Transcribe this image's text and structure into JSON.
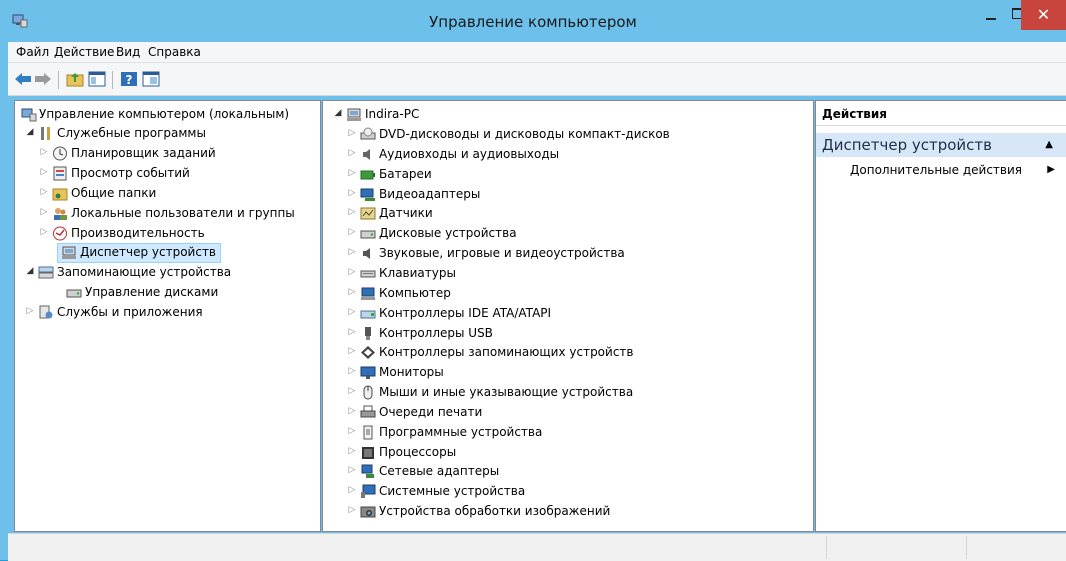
{
  "window": {
    "title": "Управление компьютером",
    "close_glyph": "✕"
  },
  "menu": [
    "Файл",
    "Действие",
    "Вид",
    "Справка"
  ],
  "toolbar": [
    "back-arrow-icon",
    "forward-arrow-icon",
    "up-folder-icon",
    "show-hide-tree-icon",
    "help-icon",
    "properties-icon"
  ],
  "left_tree": [
    {
      "label": "Управление компьютером (локальным)",
      "icon": "computer-management-icon",
      "expander": "",
      "level": 0
    },
    {
      "label": "Служебные программы",
      "icon": "tools-icon",
      "expander": "◢",
      "level": 1
    },
    {
      "label": "Планировщик заданий",
      "icon": "clock-icon",
      "expander": "▷",
      "level": 2
    },
    {
      "label": "Просмотр событий",
      "icon": "event-viewer-icon",
      "expander": "▷",
      "level": 2
    },
    {
      "label": "Общие папки",
      "icon": "shared-folder-icon",
      "expander": "▷",
      "level": 2
    },
    {
      "label": "Локальные пользователи и группы",
      "icon": "users-icon",
      "expander": "▷",
      "level": 2
    },
    {
      "label": "Производительность",
      "icon": "performance-icon",
      "expander": "▷",
      "level": 2
    },
    {
      "label": "Диспетчер устройств",
      "icon": "device-manager-icon",
      "expander": "",
      "level": 2,
      "selected": true
    },
    {
      "label": "Запоминающие устройства",
      "icon": "storage-icon",
      "expander": "◢",
      "level": 1
    },
    {
      "label": "Управление дисками",
      "icon": "disk-management-icon",
      "expander": "",
      "level": 2
    },
    {
      "label": "Службы и приложения",
      "icon": "services-icon",
      "expander": "▷",
      "level": 1
    }
  ],
  "device_tree": {
    "root": {
      "label": "Indira-PC",
      "icon": "computer-icon",
      "expander": "◢"
    },
    "items": [
      {
        "label": "DVD-дисководы и дисководы компакт-дисков",
        "icon": "dvd-drive-icon"
      },
      {
        "label": "Аудиовходы и аудиовыходы",
        "icon": "speaker-icon"
      },
      {
        "label": "Батареи",
        "icon": "battery-icon"
      },
      {
        "label": "Видеоадаптеры",
        "icon": "display-adapter-icon"
      },
      {
        "label": "Датчики",
        "icon": "sensor-icon"
      },
      {
        "label": "Дисковые устройства",
        "icon": "disk-drive-icon"
      },
      {
        "label": "Звуковые, игровые и видеоустройства",
        "icon": "sound-icon"
      },
      {
        "label": "Клавиатуры",
        "icon": "keyboard-icon"
      },
      {
        "label": "Компьютер",
        "icon": "computer-icon"
      },
      {
        "label": "Контроллеры IDE ATA/ATAPI",
        "icon": "ide-controller-icon"
      },
      {
        "label": "Контроллеры USB",
        "icon": "usb-icon"
      },
      {
        "label": "Контроллеры запоминающих устройств",
        "icon": "storage-controller-icon"
      },
      {
        "label": "Мониторы",
        "icon": "monitor-icon"
      },
      {
        "label": "Мыши и иные указывающие устройства",
        "icon": "mouse-icon"
      },
      {
        "label": "Очереди печати",
        "icon": "printer-icon"
      },
      {
        "label": "Программные устройства",
        "icon": "software-device-icon"
      },
      {
        "label": "Процессоры",
        "icon": "processor-icon"
      },
      {
        "label": "Сетевые адаптеры",
        "icon": "network-adapter-icon"
      },
      {
        "label": "Системные устройства",
        "icon": "system-device-icon"
      },
      {
        "label": "Устройства обработки изображений",
        "icon": "imaging-device-icon"
      }
    ],
    "expander": "▷"
  },
  "actions": {
    "header": "Действия",
    "section": "Диспетчер устройств",
    "section_caret": "▲",
    "items": [
      {
        "label": "Дополнительные действия",
        "caret": "▶"
      }
    ]
  },
  "colors": {
    "accent": "#6cc0ea",
    "close": "#c7453c",
    "selection": "#cde8ff",
    "section_bg": "#d8e7f7"
  }
}
